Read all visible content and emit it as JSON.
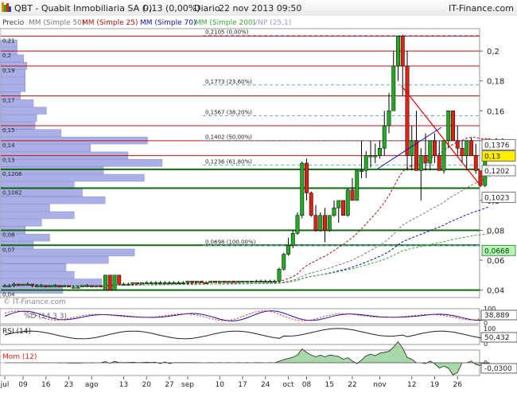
{
  "header": {
    "title": "QBT - Quabit Inmobiliaria SA (-)",
    "quote": "0,13 (0,00%)",
    "period": "Diario",
    "datetime": "22 nov 2013 09:50",
    "brand": "IT-Finance.com"
  },
  "legend": {
    "price": "Precio",
    "mm50": "MM (Simple 50)",
    "mm25": "MM (Simple 25)",
    "mm70": "MM (Simple 70)",
    "mm200": "MM (Simple 200)",
    "vnp": "VNP (25,1)"
  },
  "colors": {
    "up": "#22aa22",
    "down": "#dd2211",
    "mm50": "#777777",
    "mm25": "#aa1111",
    "mm70": "#1111aa",
    "mm200": "#33aa33",
    "vnp_bar": "#aab0e6",
    "horizontal_red": "#bb1111",
    "horizontal_green": "#116611",
    "fib": "#66aadd",
    "trend": "#dd0000"
  },
  "watermark": "© IT-Finance.com",
  "chart_data": [
    {
      "type": "candlestick",
      "panel": "price",
      "ylim": [
        0.035,
        0.215
      ],
      "yticks": [
        "0,2",
        "0,18",
        "0,16",
        "0,14",
        "0,12",
        "0,1",
        "0,08",
        "0,06",
        "0,04"
      ],
      "ytick_values": [
        0.2,
        0.18,
        0.16,
        0.14,
        0.12,
        0.1,
        0.08,
        0.06,
        0.04
      ],
      "right_badges": [
        {
          "label": "0,1376",
          "value": 0.1376,
          "color": "#ffffff"
        },
        {
          "label": "0,13",
          "value": 0.13,
          "color": "#ffee00"
        },
        {
          "label": "0,1202",
          "value": 0.1202,
          "color": "#ffffff"
        },
        {
          "label": "0,1023",
          "value": 0.1023,
          "color": "#ffffff"
        },
        {
          "label": "0,0668",
          "value": 0.0668,
          "color": "#aaffaa"
        }
      ],
      "left_levels": [
        {
          "label": "0,21",
          "value": 0.21
        },
        {
          "label": "0,2",
          "value": 0.2
        },
        {
          "label": "0,19",
          "value": 0.19
        },
        {
          "label": "0,17",
          "value": 0.17
        },
        {
          "label": "0,15",
          "value": 0.15
        },
        {
          "label": "0,14",
          "value": 0.14
        },
        {
          "label": "0,13",
          "value": 0.13
        },
        {
          "label": "0,1208",
          "value": 0.1208
        },
        {
          "label": "0,1082",
          "value": 0.1082
        },
        {
          "label": "0,08",
          "value": 0.08
        },
        {
          "label": "0,07",
          "value": 0.07
        },
        {
          "label": "0,04",
          "value": 0.04
        }
      ],
      "horizontal_lines": [
        {
          "value": 0.21,
          "color": "red"
        },
        {
          "value": 0.2,
          "color": "red"
        },
        {
          "value": 0.19,
          "color": "red"
        },
        {
          "value": 0.17,
          "color": "red"
        },
        {
          "value": 0.15,
          "color": "red"
        },
        {
          "value": 0.14,
          "color": "red"
        },
        {
          "value": 0.13,
          "color": "red"
        },
        {
          "value": 0.1208,
          "color": "green"
        },
        {
          "value": 0.1082,
          "color": "green"
        },
        {
          "value": 0.08,
          "color": "green"
        },
        {
          "value": 0.07,
          "color": "green"
        },
        {
          "value": 0.04,
          "color": "green"
        }
      ],
      "fibonacci": [
        {
          "label": "0,2105 (0,00%)",
          "value": 0.2105
        },
        {
          "label": "0,1773 (23,60%)",
          "value": 0.1773
        },
        {
          "label": "0,1567 (38,20%)",
          "value": 0.1567
        },
        {
          "label": "0,1402 (50,00%)",
          "value": 0.1402
        },
        {
          "label": "0,1236 (61,80%)",
          "value": 0.1236
        },
        {
          "label": "0,0698 (100,00%)",
          "value": 0.0698
        }
      ],
      "volume_profile": [
        {
          "price": 0.04,
          "size": 0.38
        },
        {
          "price": 0.045,
          "size": 0.62
        },
        {
          "price": 0.05,
          "size": 0.45
        },
        {
          "price": 0.055,
          "size": 0.4
        },
        {
          "price": 0.06,
          "size": 0.66
        },
        {
          "price": 0.065,
          "size": 0.82
        },
        {
          "price": 0.07,
          "size": 0.2
        },
        {
          "price": 0.075,
          "size": 0.3
        },
        {
          "price": 0.08,
          "size": 0.15
        },
        {
          "price": 0.085,
          "size": 0.25
        },
        {
          "price": 0.09,
          "size": 0.45
        },
        {
          "price": 0.095,
          "size": 0.3
        },
        {
          "price": 0.1,
          "size": 0.64
        },
        {
          "price": 0.105,
          "size": 0.5
        },
        {
          "price": 0.11,
          "size": 0.45
        },
        {
          "price": 0.115,
          "size": 0.88
        },
        {
          "price": 0.12,
          "size": 0.63
        },
        {
          "price": 0.125,
          "size": 0.99
        },
        {
          "price": 0.13,
          "size": 0.78
        },
        {
          "price": 0.135,
          "size": 0.55
        },
        {
          "price": 0.14,
          "size": 0.9
        },
        {
          "price": 0.145,
          "size": 0.37
        },
        {
          "price": 0.15,
          "size": 0.21
        },
        {
          "price": 0.155,
          "size": 0.22
        },
        {
          "price": 0.16,
          "size": 0.28
        },
        {
          "price": 0.165,
          "size": 0.2
        },
        {
          "price": 0.17,
          "size": 0.12
        },
        {
          "price": 0.175,
          "size": 0.15
        },
        {
          "price": 0.18,
          "size": 0.15
        },
        {
          "price": 0.185,
          "size": 0.15
        },
        {
          "price": 0.19,
          "size": 0.16
        },
        {
          "price": 0.195,
          "size": 0.14
        },
        {
          "price": 0.2,
          "size": 0.1
        },
        {
          "price": 0.205,
          "size": 0.1
        }
      ],
      "candles": [
        [
          0.043,
          0.044,
          0.042,
          0.043
        ],
        [
          0.043,
          0.044,
          0.042,
          0.043
        ],
        [
          0.043,
          0.045,
          0.042,
          0.044
        ],
        [
          0.044,
          0.044,
          0.043,
          0.043
        ],
        [
          0.043,
          0.044,
          0.043,
          0.044
        ],
        [
          0.044,
          0.045,
          0.043,
          0.044
        ],
        [
          0.044,
          0.044,
          0.042,
          0.043
        ],
        [
          0.043,
          0.044,
          0.042,
          0.043
        ],
        [
          0.043,
          0.044,
          0.042,
          0.043
        ],
        [
          0.043,
          0.043,
          0.042,
          0.042
        ],
        [
          0.042,
          0.043,
          0.042,
          0.043
        ],
        [
          0.043,
          0.044,
          0.042,
          0.043
        ],
        [
          0.043,
          0.043,
          0.042,
          0.042
        ],
        [
          0.042,
          0.043,
          0.042,
          0.043
        ],
        [
          0.043,
          0.043,
          0.042,
          0.042
        ],
        [
          0.042,
          0.043,
          0.042,
          0.042
        ],
        [
          0.042,
          0.043,
          0.041,
          0.042
        ],
        [
          0.042,
          0.043,
          0.042,
          0.043
        ],
        [
          0.043,
          0.044,
          0.042,
          0.043
        ],
        [
          0.043,
          0.043,
          0.042,
          0.042
        ],
        [
          0.042,
          0.043,
          0.042,
          0.043
        ],
        [
          0.043,
          0.043,
          0.042,
          0.042
        ],
        [
          0.04,
          0.05,
          0.04,
          0.05
        ],
        [
          0.05,
          0.05,
          0.04,
          0.04
        ],
        [
          0.04,
          0.05,
          0.04,
          0.05
        ],
        [
          0.05,
          0.05,
          0.043,
          0.044
        ],
        [
          0.044,
          0.045,
          0.043,
          0.044
        ],
        [
          0.044,
          0.045,
          0.043,
          0.044
        ],
        [
          0.044,
          0.045,
          0.043,
          0.045
        ],
        [
          0.045,
          0.045,
          0.044,
          0.044
        ],
        [
          0.044,
          0.045,
          0.044,
          0.045
        ],
        [
          0.045,
          0.046,
          0.044,
          0.045
        ],
        [
          0.045,
          0.046,
          0.044,
          0.045
        ],
        [
          0.045,
          0.046,
          0.044,
          0.045
        ],
        [
          0.045,
          0.046,
          0.044,
          0.045
        ],
        [
          0.045,
          0.046,
          0.044,
          0.045
        ],
        [
          0.045,
          0.046,
          0.044,
          0.045
        ],
        [
          0.045,
          0.046,
          0.044,
          0.045
        ],
        [
          0.045,
          0.046,
          0.044,
          0.045
        ],
        [
          0.045,
          0.046,
          0.044,
          0.045
        ],
        [
          0.045,
          0.046,
          0.044,
          0.046
        ],
        [
          0.046,
          0.046,
          0.045,
          0.045
        ],
        [
          0.045,
          0.046,
          0.045,
          0.046
        ],
        [
          0.046,
          0.046,
          0.045,
          0.045
        ],
        [
          0.045,
          0.046,
          0.045,
          0.045
        ],
        [
          0.045,
          0.046,
          0.045,
          0.046
        ],
        [
          0.046,
          0.046,
          0.045,
          0.045
        ],
        [
          0.045,
          0.046,
          0.045,
          0.046
        ],
        [
          0.046,
          0.046,
          0.045,
          0.045
        ],
        [
          0.045,
          0.046,
          0.045,
          0.046
        ],
        [
          0.046,
          0.046,
          0.045,
          0.045
        ],
        [
          0.045,
          0.046,
          0.045,
          0.046
        ],
        [
          0.046,
          0.046,
          0.045,
          0.046
        ],
        [
          0.046,
          0.046,
          0.045,
          0.046
        ],
        [
          0.046,
          0.046,
          0.045,
          0.046
        ],
        [
          0.046,
          0.047,
          0.045,
          0.046
        ],
        [
          0.046,
          0.047,
          0.045,
          0.046
        ],
        [
          0.046,
          0.047,
          0.045,
          0.046
        ],
        [
          0.046,
          0.047,
          0.045,
          0.046
        ],
        [
          0.046,
          0.047,
          0.045,
          0.046
        ],
        [
          0.046,
          0.055,
          0.045,
          0.054
        ],
        [
          0.054,
          0.065,
          0.053,
          0.064
        ],
        [
          0.064,
          0.075,
          0.063,
          0.07
        ],
        [
          0.07,
          0.08,
          0.068,
          0.078
        ],
        [
          0.078,
          0.092,
          0.077,
          0.09
        ],
        [
          0.09,
          0.126,
          0.088,
          0.125
        ],
        [
          0.125,
          0.128,
          0.1,
          0.105
        ],
        [
          0.105,
          0.106,
          0.089,
          0.09
        ],
        [
          0.09,
          0.097,
          0.079,
          0.08
        ],
        [
          0.08,
          0.092,
          0.079,
          0.09
        ],
        [
          0.09,
          0.095,
          0.072,
          0.08
        ],
        [
          0.08,
          0.09,
          0.079,
          0.09
        ],
        [
          0.09,
          0.1,
          0.089,
          0.095
        ],
        [
          0.095,
          0.1,
          0.085,
          0.1
        ],
        [
          0.1,
          0.1,
          0.09,
          0.09
        ],
        [
          0.09,
          0.108,
          0.089,
          0.107
        ],
        [
          0.107,
          0.115,
          0.1,
          0.1
        ],
        [
          0.1,
          0.12,
          0.1,
          0.12
        ],
        [
          0.12,
          0.14,
          0.115,
          0.12
        ],
        [
          0.12,
          0.133,
          0.115,
          0.13
        ],
        [
          0.13,
          0.14,
          0.122,
          0.13
        ],
        [
          0.13,
          0.138,
          0.125,
          0.13
        ],
        [
          0.13,
          0.14,
          0.128,
          0.135
        ],
        [
          0.135,
          0.16,
          0.13,
          0.15
        ],
        [
          0.15,
          0.172,
          0.145,
          0.16
        ],
        [
          0.16,
          0.2,
          0.16,
          0.19
        ],
        [
          0.19,
          0.21,
          0.18,
          0.21
        ],
        [
          0.21,
          0.211,
          0.17,
          0.19
        ],
        [
          0.19,
          0.2,
          0.12,
          0.13
        ],
        [
          0.13,
          0.15,
          0.12,
          0.14
        ],
        [
          0.14,
          0.16,
          0.121,
          0.12
        ],
        [
          0.12,
          0.135,
          0.1,
          0.13
        ],
        [
          0.13,
          0.145,
          0.12,
          0.125
        ],
        [
          0.125,
          0.14,
          0.12,
          0.14
        ],
        [
          0.14,
          0.145,
          0.125,
          0.13
        ],
        [
          0.13,
          0.14,
          0.12,
          0.12
        ],
        [
          0.12,
          0.14,
          0.118,
          0.14
        ],
        [
          0.14,
          0.16,
          0.135,
          0.16
        ],
        [
          0.16,
          0.16,
          0.14,
          0.14
        ],
        [
          0.14,
          0.15,
          0.13,
          0.135
        ],
        [
          0.135,
          0.14,
          0.125,
          0.13
        ],
        [
          0.13,
          0.14,
          0.12,
          0.14
        ],
        [
          0.14,
          0.142,
          0.13,
          0.13
        ],
        [
          0.13,
          0.138,
          0.118,
          0.12
        ],
        [
          0.12,
          0.12,
          0.109,
          0.11
        ],
        [
          0.11,
          0.131,
          0.109,
          0.13
        ],
        [
          0.13,
          0.131,
          0.128,
          0.13
        ]
      ],
      "x_ticks": [
        {
          "label": "jul",
          "index": 0
        },
        {
          "label": "09",
          "index": 4
        },
        {
          "label": "16",
          "index": 9
        },
        {
          "label": "23",
          "index": 14
        },
        {
          "label": "ago",
          "index": 19
        },
        {
          "label": "13",
          "index": 26
        },
        {
          "label": "20",
          "index": 31
        },
        {
          "label": "27",
          "index": 36
        },
        {
          "label": "sep",
          "index": 40
        },
        {
          "label": "10",
          "index": 47
        },
        {
          "label": "17",
          "index": 52
        },
        {
          "label": "24",
          "index": 57
        },
        {
          "label": "oct",
          "index": 62
        },
        {
          "label": "08",
          "index": 66
        },
        {
          "label": "15",
          "index": 71
        },
        {
          "label": "22",
          "index": 76
        },
        {
          "label": "nov",
          "index": 82
        },
        {
          "label": "12",
          "index": 89
        },
        {
          "label": "19",
          "index": 94
        },
        {
          "label": "26",
          "index": 99
        }
      ]
    },
    {
      "type": "line",
      "panel": "stochastic",
      "label": "%D (14 3 3)",
      "ylim": [
        0,
        100
      ],
      "last_value": "38,889",
      "yticks": [
        "100",
        "50",
        "0"
      ]
    },
    {
      "type": "line",
      "panel": "rsi",
      "label": "RSI (14)",
      "ylim": [
        0,
        100
      ],
      "last_value": "50,432",
      "yticks": [
        "100",
        "50",
        "0"
      ]
    },
    {
      "type": "area",
      "panel": "momentum",
      "label": "Mom (12)",
      "last_value": "-0,0300",
      "yticks": [
        "0"
      ]
    }
  ]
}
